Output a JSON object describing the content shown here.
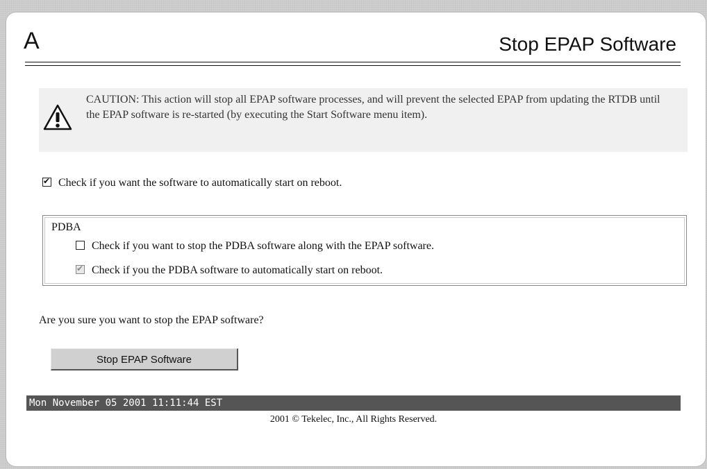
{
  "header": {
    "app_letter": "A",
    "title": "Stop EPAP Software"
  },
  "caution": {
    "icon": "warning-triangle-icon",
    "text": "CAUTION: This action will stop all EPAP software processes, and will prevent the selected EPAP from updating the RTDB until the EPAP software is re-started (by executing the Start Software menu item)."
  },
  "options": {
    "auto_start": {
      "label": "Check if you want the software to automatically start on reboot.",
      "checked": true
    }
  },
  "pdba": {
    "heading": "PDBA",
    "stop_pdba": {
      "label": "Check if you want to stop the PDBA software along with the EPAP software.",
      "checked": false
    },
    "pdba_auto_start": {
      "label": "Check if you the PDBA software to automatically start on reboot.",
      "checked": true,
      "disabled": true
    }
  },
  "confirm": {
    "question": "Are you sure you want to stop the EPAP software?",
    "button_label": "Stop EPAP Software"
  },
  "footer": {
    "timestamp": "Mon November 05 2001 11:11:44 EST",
    "copyright": "2001 © Tekelec, Inc., All Rights Reserved."
  },
  "colors": {
    "status_bar": "#555555",
    "caution_bg": "#f0f0f0",
    "button_bg": "#d0d0d0"
  }
}
